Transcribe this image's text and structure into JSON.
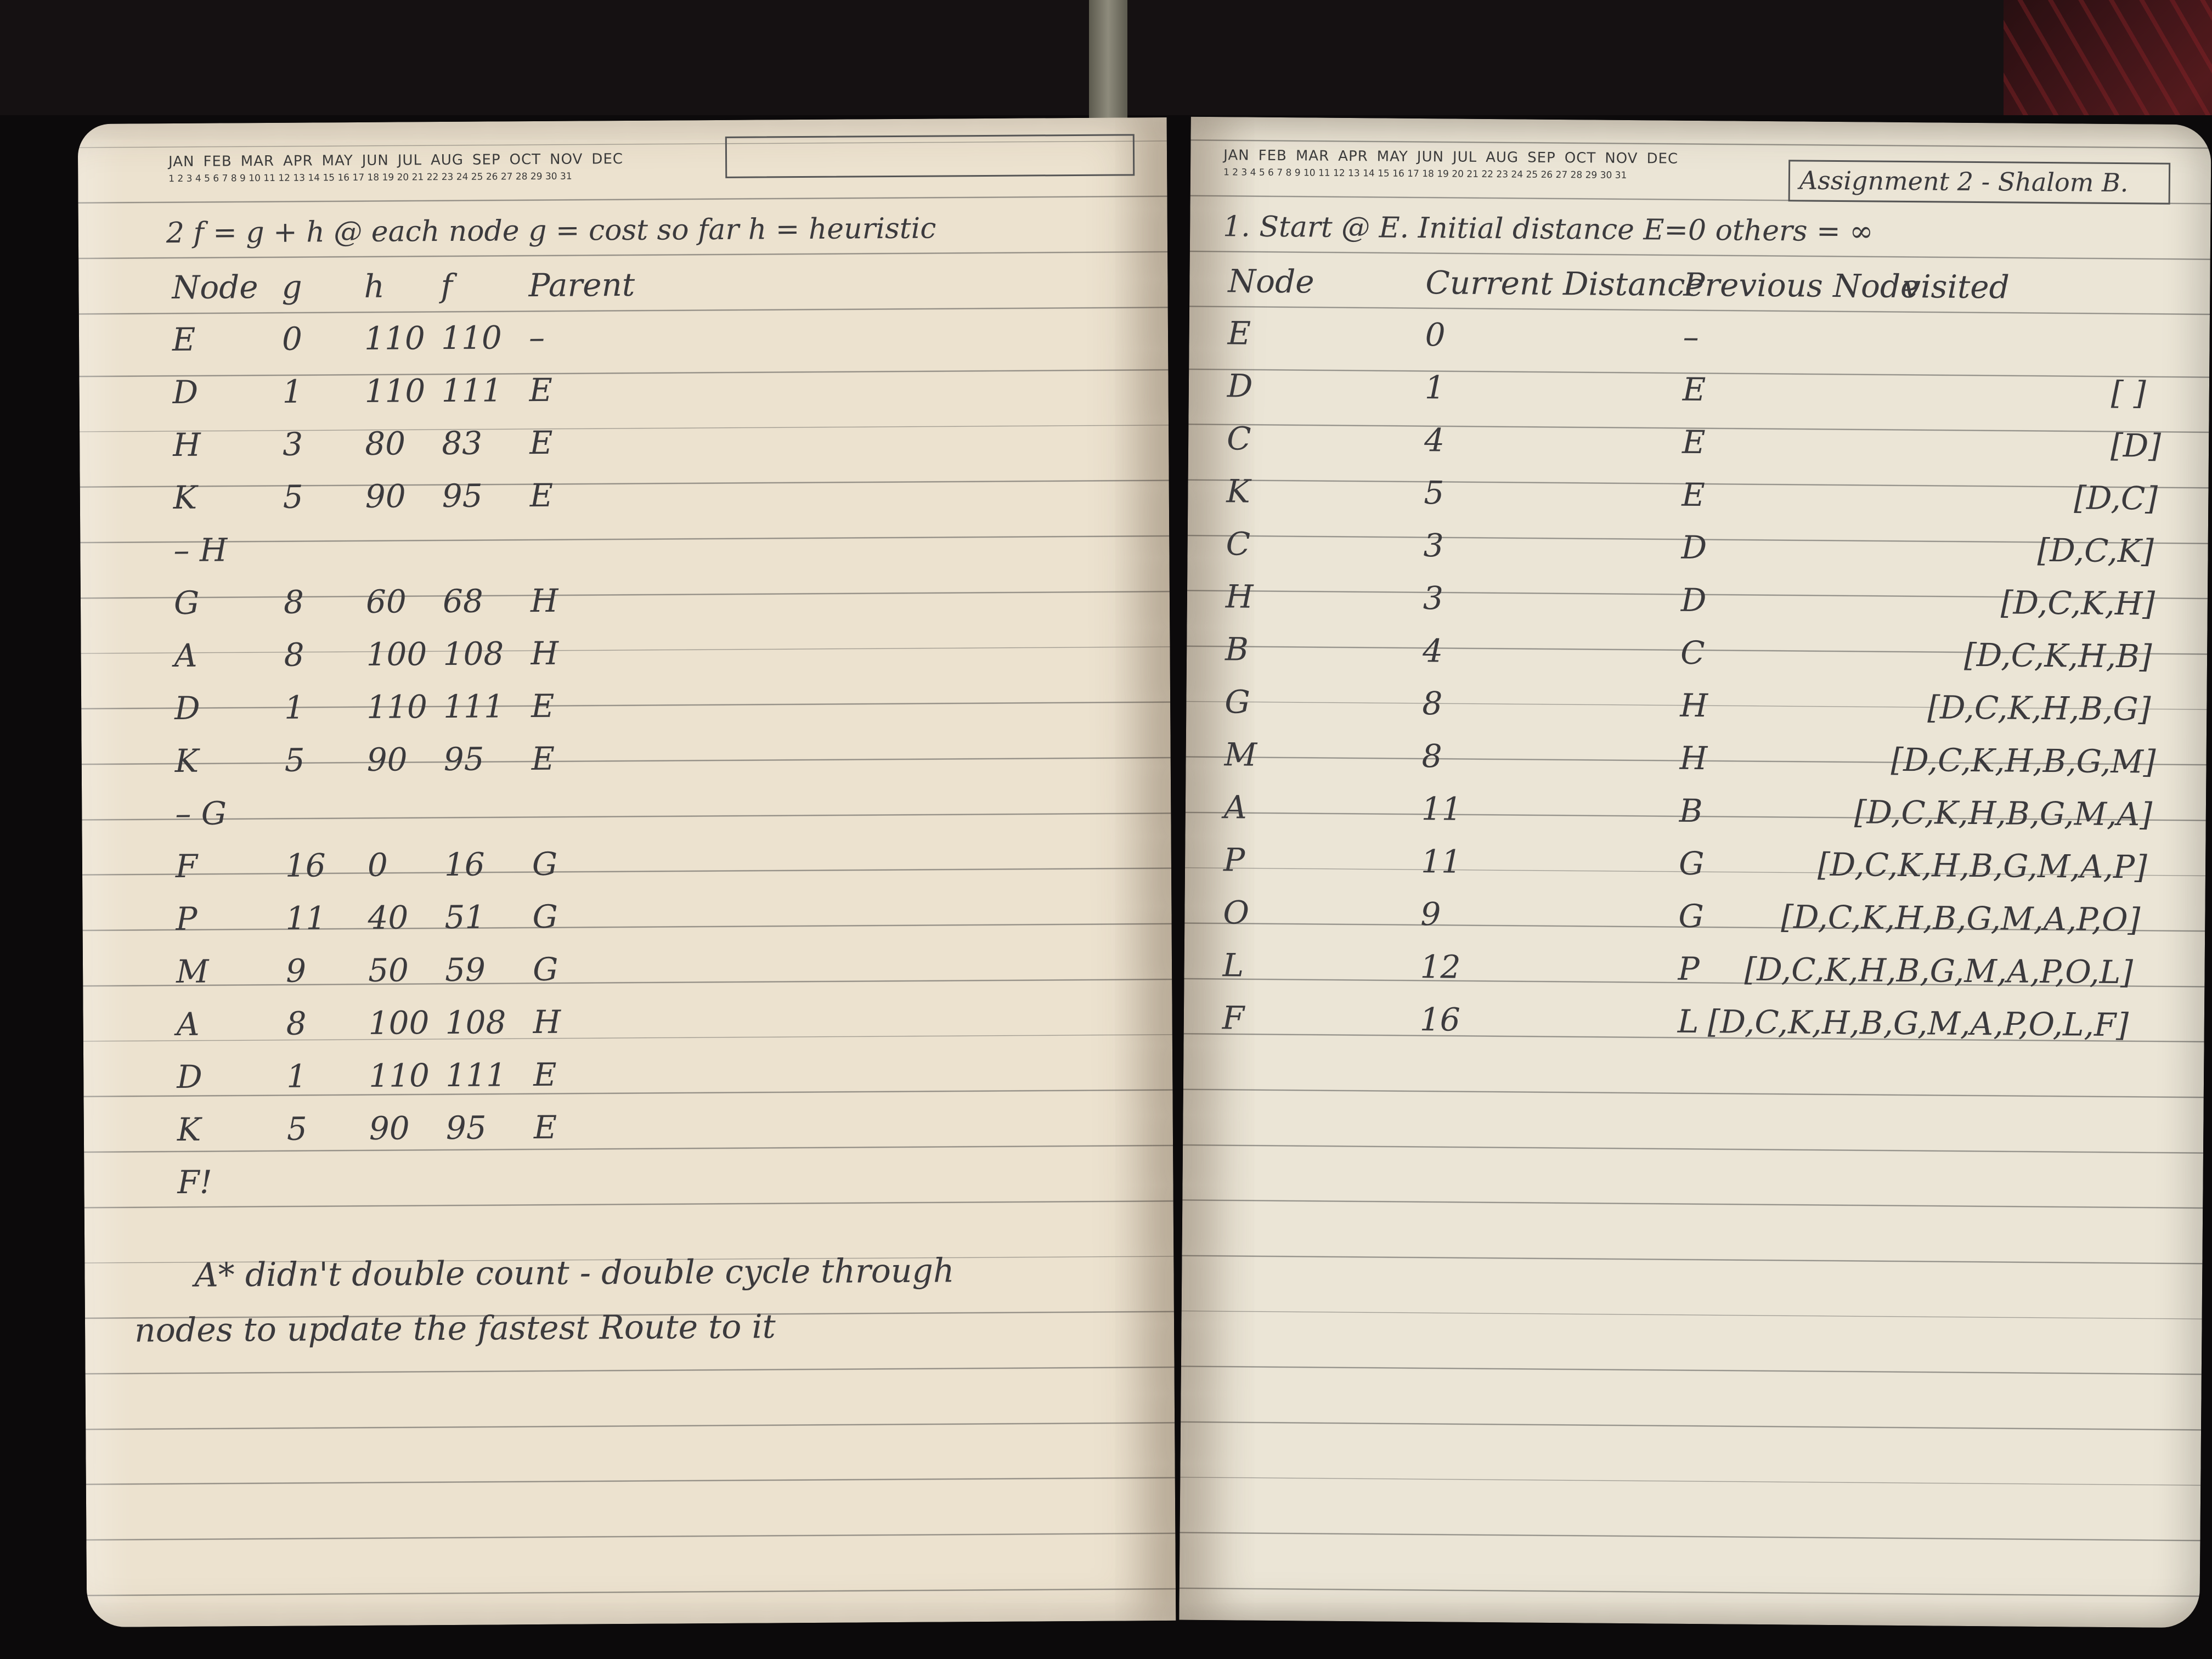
{
  "header": {
    "months": [
      "JAN",
      "FEB",
      "MAR",
      "APR",
      "MAY",
      "JUN",
      "JUL",
      "AUG",
      "SEP",
      "OCT",
      "NOV",
      "DEC"
    ],
    "days": "1 2 3 4 5 6 7 8 9 10 11 12 13 14 15 16 17 18 19 20 21 22 23 24 25 26 27 28 29 30 31"
  },
  "left": {
    "title_line": "2 f = g + h  @ each node   g = cost so far   h = heuristic",
    "col_headers": [
      "Node",
      "g",
      "h",
      "f",
      "Parent"
    ],
    "rows": [
      [
        "E",
        "0",
        "110",
        "110",
        "–"
      ],
      [
        "D",
        "1",
        "110",
        "111",
        "E"
      ],
      [
        "H",
        "3",
        "80",
        "83",
        "E"
      ],
      [
        "K",
        "5",
        "90",
        "95",
        "E"
      ],
      [
        "– H",
        "",
        "",
        "",
        ""
      ],
      [
        "G",
        "8",
        "60",
        "68",
        "H"
      ],
      [
        "A",
        "8",
        "100",
        "108",
        "H"
      ],
      [
        "D",
        "1",
        "110",
        "111",
        "E"
      ],
      [
        "K",
        "5",
        "90",
        "95",
        "E"
      ],
      [
        "– G",
        "",
        "",
        "",
        ""
      ],
      [
        "F",
        "16",
        "0",
        "16",
        "G"
      ],
      [
        "P",
        "11",
        "40",
        "51",
        "G"
      ],
      [
        "M",
        "9",
        "50",
        "59",
        "G"
      ],
      [
        "A",
        "8",
        "100",
        "108",
        "H"
      ],
      [
        "D",
        "1",
        "110",
        "111",
        "E"
      ],
      [
        "K",
        "5",
        "90",
        "95",
        "E"
      ],
      [
        "F!",
        "",
        "",
        "",
        ""
      ]
    ],
    "note_line1": "A* didn't double count - double cycle through",
    "note_line2": "nodes to update the fastest Route to it"
  },
  "right": {
    "box_label": "Assignment 2 - Shalom B.",
    "title_line": "1. Start @ E.  Initial distance  E=0  others = ∞",
    "col_headers": [
      "Node",
      "Current Distance",
      "Previous Node",
      "visited"
    ],
    "rows": [
      [
        "E",
        "0",
        "–",
        ""
      ],
      [
        "D",
        "1",
        "E",
        "[ ]"
      ],
      [
        "C",
        "4",
        "E",
        "[D]"
      ],
      [
        "K",
        "5",
        "E",
        "[D,C]"
      ],
      [
        "C",
        "3",
        "D",
        "[D,C,K]"
      ],
      [
        "H",
        "3",
        "D",
        "[D,C,K,H]"
      ],
      [
        "B",
        "4",
        "C",
        "[D,C,K,H,B]"
      ],
      [
        "G",
        "8",
        "H",
        "[D,C,K,H,B,G]"
      ],
      [
        "M",
        "8",
        "H",
        "[D,C,K,H,B,G,M]"
      ],
      [
        "A",
        "11",
        "B",
        "[D,C,K,H,B,G,M,A]"
      ],
      [
        "P",
        "11",
        "G",
        "[D,C,K,H,B,G,M,A,P]"
      ],
      [
        "O",
        "9",
        "G",
        "[D,C,K,H,B,G,M,A,P,O]"
      ],
      [
        "L",
        "12",
        "P",
        "[D,C,K,H,B,G,M,A,P,O,L]"
      ],
      [
        "F",
        "16",
        "L",
        "[D,C,K,H,B,G,M,A,P,O,L,F]"
      ]
    ]
  }
}
